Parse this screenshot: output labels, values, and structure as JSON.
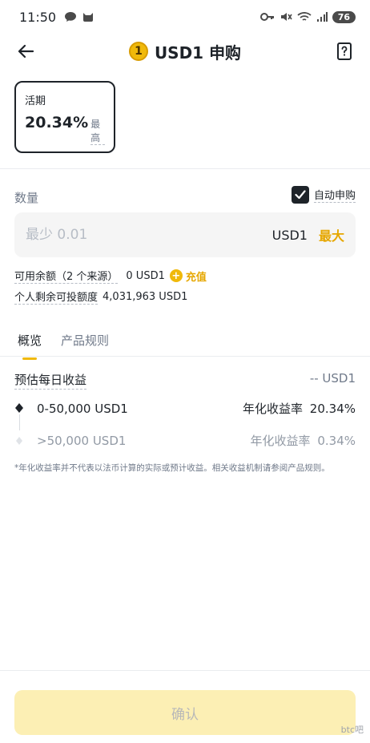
{
  "status_bar": {
    "time": "11:50",
    "battery": "76"
  },
  "header": {
    "title": "USD1 申购",
    "coin_symbol": "1"
  },
  "term_card": {
    "label": "活期",
    "rate": "20.34%",
    "max_label": "最高"
  },
  "quantity": {
    "label": "数量",
    "auto_subscribe_label": "自动申购",
    "auto_subscribe_checked": true,
    "placeholder": "最少 0.01",
    "unit": "USD1",
    "max_label": "最大"
  },
  "balance": {
    "available_label": "可用余额（2 个来源）",
    "available_value": "0 USD1",
    "recharge_label": "充值",
    "quota_label": "个人剩余可投额度",
    "quota_value": "4,031,963 USD1"
  },
  "tabs": [
    {
      "label": "概览",
      "active": true
    },
    {
      "label": "产品规则",
      "active": false
    }
  ],
  "estimate": {
    "label": "预估每日收益",
    "value": "-- USD1"
  },
  "tiers": [
    {
      "range": "0-50,000 USD1",
      "apr_label": "年化收益率",
      "apr": "20.34%"
    },
    {
      "range": ">50,000 USD1",
      "apr_label": "年化收益率",
      "apr": "0.34%"
    }
  ],
  "footnote": "*年化收益率并不代表以法币计算的实际或预计收益。相关收益机制请参阅产品规则。",
  "confirm_button": "确认",
  "watermark": "btc吧",
  "colors": {
    "accent": "#f0b90b",
    "accent_text": "#e6a700",
    "confirm_disabled_bg": "#fcefb4",
    "text_primary": "#1e2329",
    "text_secondary": "#707a8a"
  }
}
